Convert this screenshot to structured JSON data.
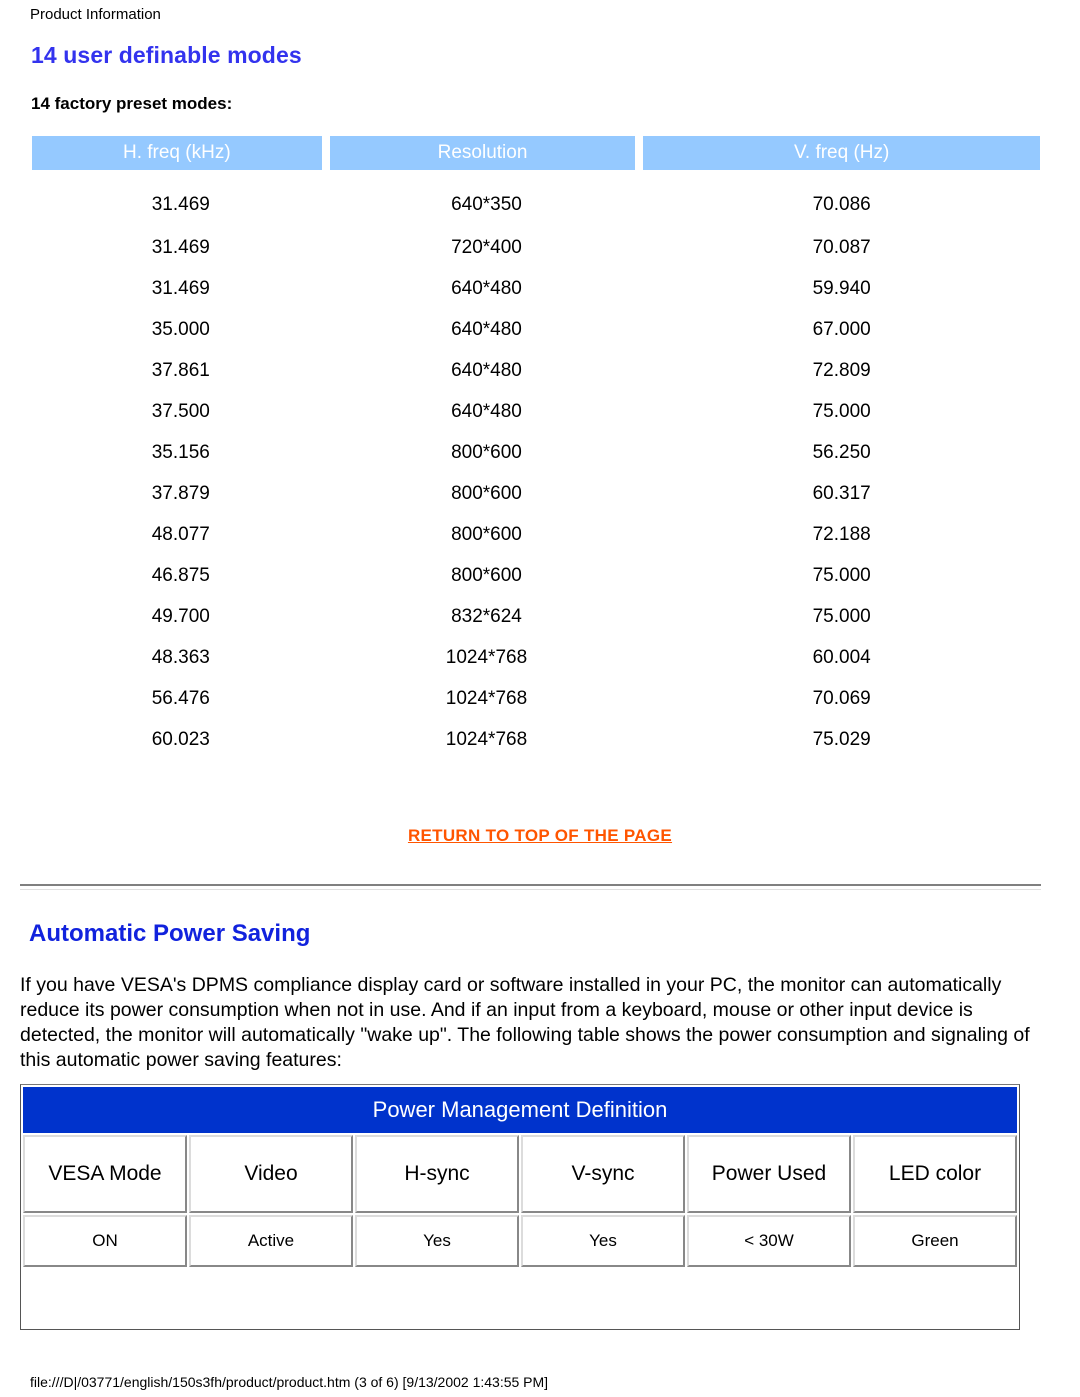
{
  "breadcrumb": "Product Information",
  "headings": {
    "main": "14 user definable modes",
    "sub": "14 factory preset modes:",
    "power_saving": "Automatic Power Saving"
  },
  "colors": {
    "heading_blue": "#3333ee",
    "table_header_light_blue": "#95c9ff",
    "pm_header_blue": "#0033cc",
    "link_orange": "#ff5500"
  },
  "preset_table": {
    "columns": [
      "H. freq (kHz)",
      "Resolution",
      "V. freq (Hz)"
    ],
    "rows": [
      [
        "31.469",
        "640*350",
        "70.086"
      ],
      [
        "31.469",
        "720*400",
        "70.087"
      ],
      [
        "31.469",
        "640*480",
        "59.940"
      ],
      [
        "35.000",
        "640*480",
        "67.000"
      ],
      [
        "37.861",
        "640*480",
        "72.809"
      ],
      [
        "37.500",
        "640*480",
        "75.000"
      ],
      [
        "35.156",
        "800*600",
        "56.250"
      ],
      [
        "37.879",
        "800*600",
        "60.317"
      ],
      [
        "48.077",
        "800*600",
        "72.188"
      ],
      [
        "46.875",
        "800*600",
        "75.000"
      ],
      [
        "49.700",
        "832*624",
        "75.000"
      ],
      [
        "48.363",
        "1024*768",
        "60.004"
      ],
      [
        "56.476",
        "1024*768",
        "70.069"
      ],
      [
        "60.023",
        "1024*768",
        "75.029"
      ]
    ]
  },
  "return_link": "RETURN TO TOP OF THE PAGE",
  "paragraph": "If you have VESA's DPMS compliance display card or software installed in your PC, the monitor can automatically reduce its power consumption when not in use. And if an input from a keyboard, mouse or other input device is detected, the monitor will automatically \"wake up\". The following table shows the power consumption and signaling of this automatic power saving features:",
  "power_table": {
    "title": "Power Management Definition",
    "columns": [
      "VESA Mode",
      "Video",
      "H-sync",
      "V-sync",
      "Power Used",
      "LED color"
    ],
    "rows": [
      [
        "ON",
        "Active",
        "Yes",
        "Yes",
        "< 30W",
        "Green"
      ]
    ]
  },
  "footer": "file:///D|/03771/english/150s3fh/product/product.htm (3 of 6) [9/13/2002 1:43:55 PM]"
}
